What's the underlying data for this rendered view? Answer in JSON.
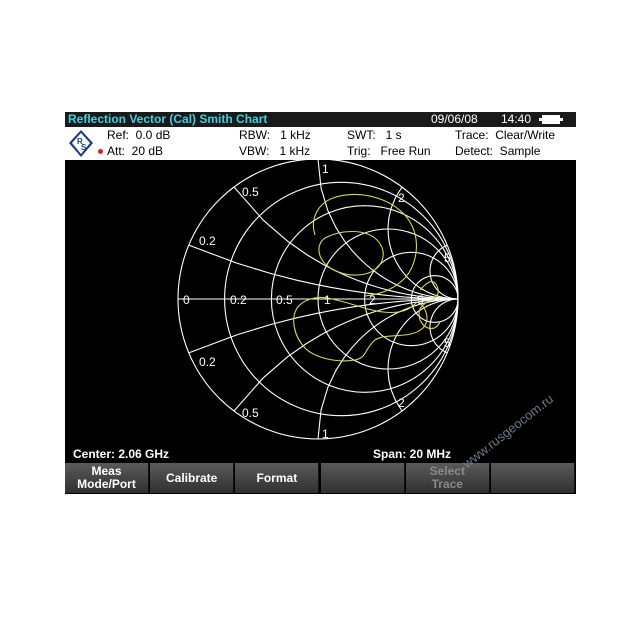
{
  "title_bar": {
    "title": "Reflection Vector (Cal) Smith Chart",
    "date": "09/06/08",
    "time": "14:40"
  },
  "info": {
    "ref": "Ref:  0.0 dB",
    "att": "Att:  20 dB",
    "rbw": "RBW:   1 kHz",
    "vbw": "VBW:   1 kHz",
    "swt": "SWT:   1 s",
    "trig": "Trig:   Free Run",
    "trace": "Trace:  Clear/Write",
    "detect": "Detect:  Sample"
  },
  "smith_chart": {
    "labels": {
      "r0": "0",
      "r02": "0.2",
      "r05": "0.5",
      "r1": "1",
      "r2": "2",
      "r5": "5",
      "x02_top": "0.2",
      "x05_top": "0.5",
      "x1_top": "1",
      "x2_top": "2",
      "x5_top": "5",
      "x02_bot": "0.2",
      "x05_bot": "0.5",
      "x1_bot": "1",
      "x2_bot": "2",
      "x5_bot": "5"
    },
    "colors": {
      "grid": "#ffffff",
      "trace": "#d8d84a",
      "background": "#000000"
    }
  },
  "footer": {
    "center": "Center:  2.06 GHz",
    "span": "Span:    20 MHz"
  },
  "softkeys": [
    {
      "label": "Meas\nMode/Port",
      "enabled": true
    },
    {
      "label": "Calibrate",
      "enabled": true
    },
    {
      "label": "Format",
      "enabled": true
    },
    {
      "label": "",
      "enabled": true
    },
    {
      "label": "Select\nTrace",
      "enabled": false
    },
    {
      "label": "",
      "enabled": true
    }
  ],
  "watermark": "www.rusgeocom.ru"
}
